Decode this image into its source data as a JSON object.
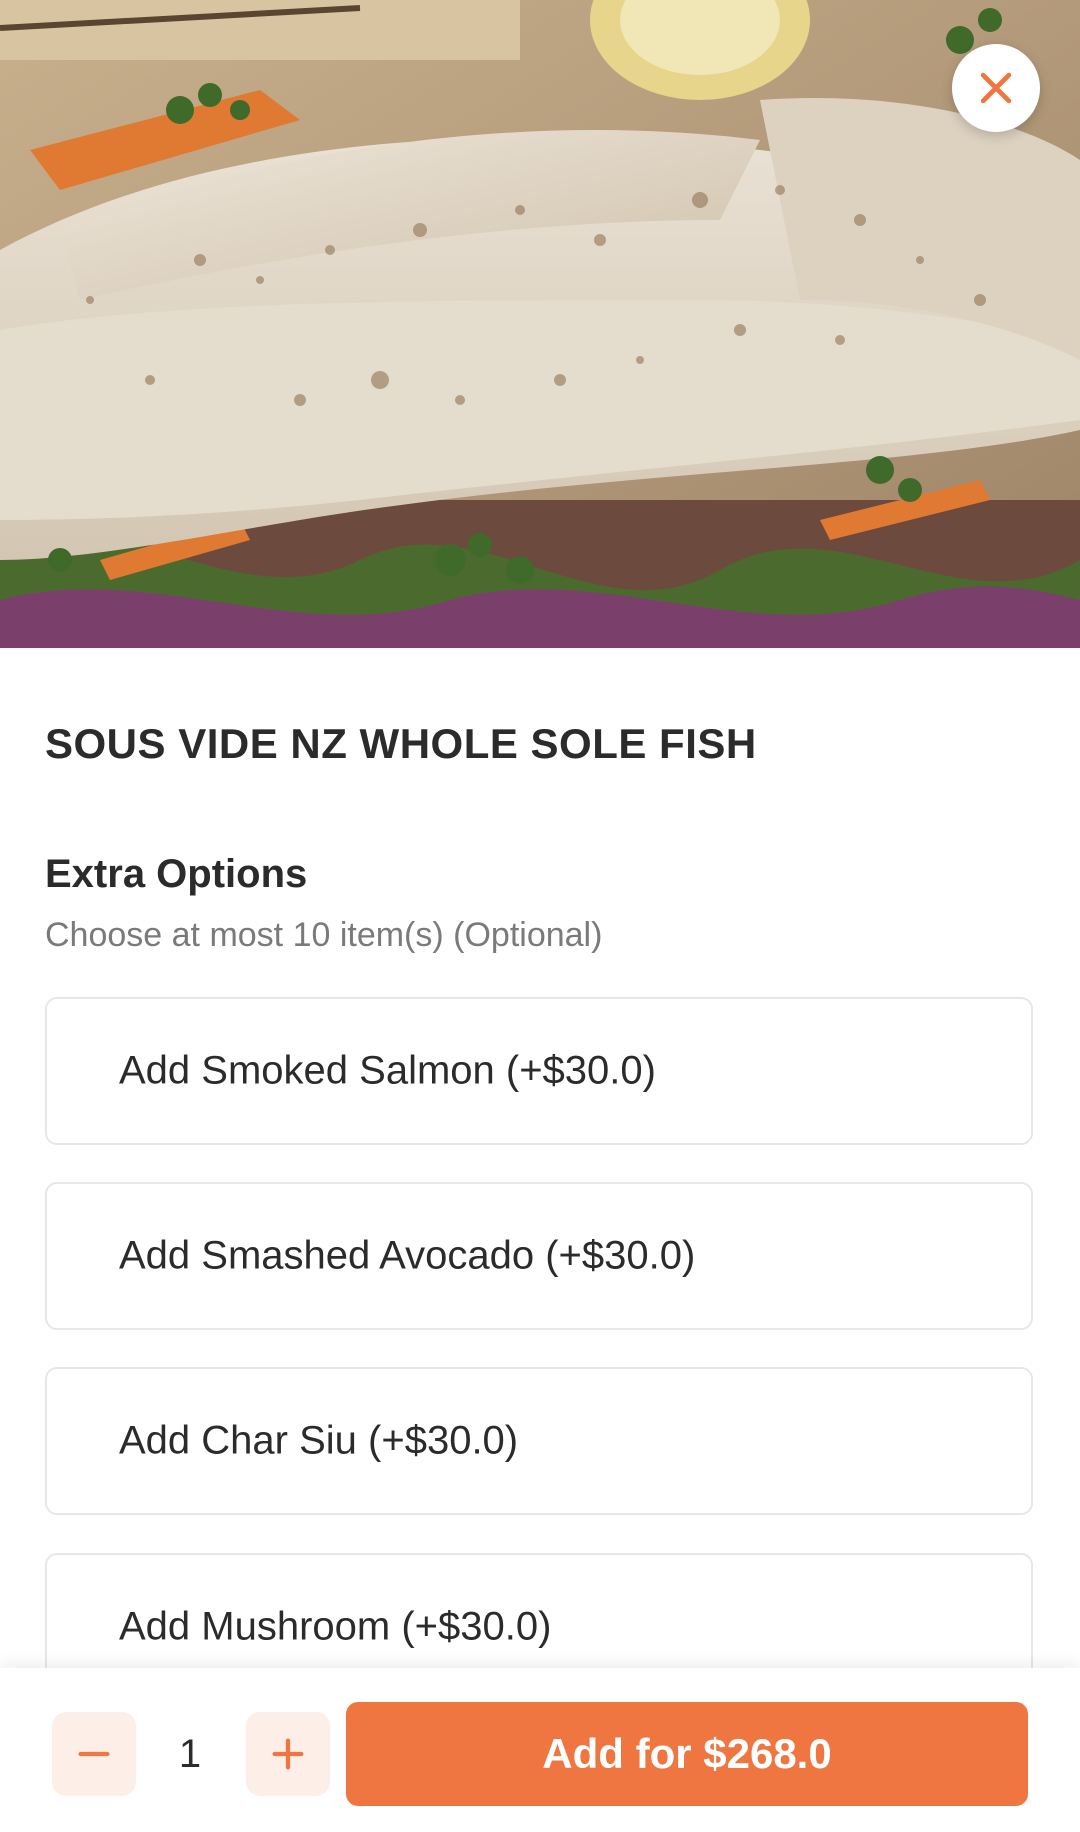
{
  "product": {
    "title": "SOUS VIDE NZ WHOLE SOLE FISH",
    "image_description_icon": "food-photo"
  },
  "close": {
    "icon": "close-icon"
  },
  "extra_options": {
    "heading": "Extra Options",
    "subtext": "Choose at most 10 item(s) (Optional)",
    "items": [
      {
        "label": "Add Smoked Salmon (+$30.0)"
      },
      {
        "label": "Add Smashed Avocado (+$30.0)"
      },
      {
        "label": "Add Char Siu (+$30.0)"
      },
      {
        "label": "Add Mushroom (+$30.0)"
      }
    ]
  },
  "cart": {
    "quantity": "1",
    "add_button_label": "Add for $268.0",
    "decrement_icon": "minus-icon",
    "increment_icon": "plus-icon"
  },
  "colors": {
    "accent": "#ef7640",
    "accent_light": "#fdeee8",
    "text_primary": "#2b2b2b",
    "text_secondary": "#7a7a7a",
    "border": "#e7e7e7"
  }
}
